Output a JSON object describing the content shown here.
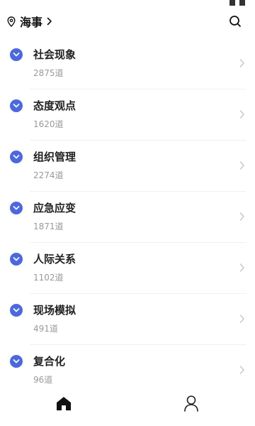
{
  "header": {
    "location": "海事",
    "location_icon": "location-pin-icon",
    "search_icon": "search-icon"
  },
  "categories": [
    {
      "title": "社会现象",
      "count": "2875道"
    },
    {
      "title": "态度观点",
      "count": "1620道"
    },
    {
      "title": "组织管理",
      "count": "2274道"
    },
    {
      "title": "应急应变",
      "count": "1871道"
    },
    {
      "title": "人际关系",
      "count": "1102道"
    },
    {
      "title": "现场模拟",
      "count": "491道"
    },
    {
      "title": "复合化",
      "count": "96道"
    }
  ],
  "tabbar": {
    "active": "home",
    "items": [
      {
        "icon": "home-icon"
      },
      {
        "icon": "profile-icon"
      }
    ]
  },
  "colors": {
    "accent": "#4a67e8",
    "muted": "#999999",
    "text": "#222222"
  }
}
